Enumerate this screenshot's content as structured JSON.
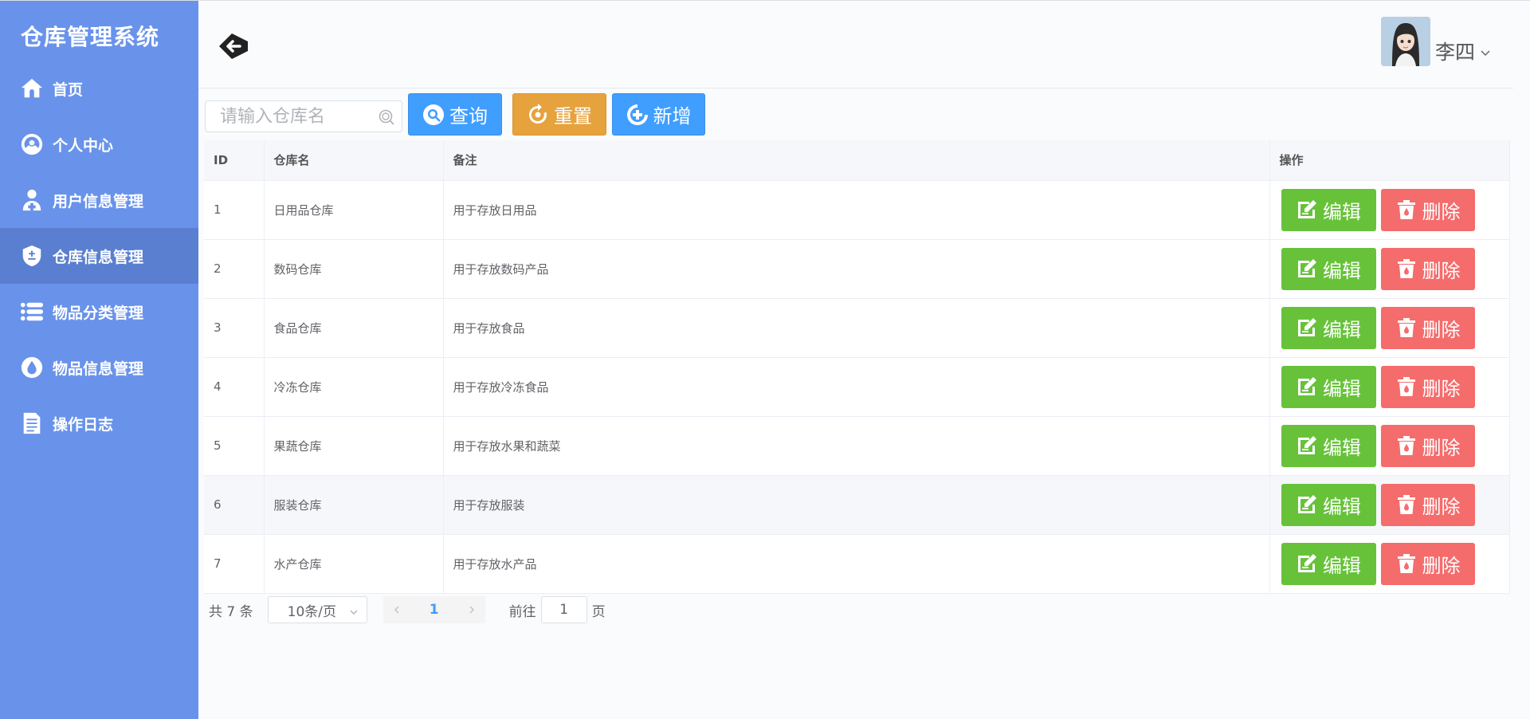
{
  "sidebar": {
    "title": "仓库管理系统",
    "items": [
      {
        "label": "首页",
        "icon": "home-icon"
      },
      {
        "label": "个人中心",
        "icon": "user-center-icon"
      },
      {
        "label": "用户信息管理",
        "icon": "user-add-icon"
      },
      {
        "label": "仓库信息管理",
        "icon": "shield-icon",
        "active": true
      },
      {
        "label": "物品分类管理",
        "icon": "list-icon"
      },
      {
        "label": "物品信息管理",
        "icon": "drop-icon"
      },
      {
        "label": "操作日志",
        "icon": "document-icon"
      }
    ]
  },
  "header": {
    "username": "李四"
  },
  "toolbar": {
    "search_placeholder": "请输入仓库名",
    "query_label": "查询",
    "reset_label": "重置",
    "add_label": "新增"
  },
  "table": {
    "columns": [
      "ID",
      "仓库名",
      "备注",
      "操作"
    ],
    "rows": [
      {
        "id": "1",
        "name": "日用品仓库",
        "remark": "用于存放日用品"
      },
      {
        "id": "2",
        "name": "数码仓库",
        "remark": "用于存放数码产品"
      },
      {
        "id": "3",
        "name": "食品仓库",
        "remark": "用于存放食品"
      },
      {
        "id": "4",
        "name": "冷冻仓库",
        "remark": "用于存放冷冻食品"
      },
      {
        "id": "5",
        "name": "果蔬仓库",
        "remark": "用于存放水果和蔬菜"
      },
      {
        "id": "6",
        "name": "服装仓库",
        "remark": "用于存放服装"
      },
      {
        "id": "7",
        "name": "水产仓库",
        "remark": "用于存放水产品"
      }
    ],
    "edit_label": "编辑",
    "delete_label": "删除"
  },
  "pagination": {
    "total_text": "共 7 条",
    "page_size": "10条/页",
    "current_page": "1",
    "goto_label": "前往",
    "goto_value": "1",
    "goto_suffix": "页"
  },
  "colors": {
    "sidebar_bg": "#6993ea",
    "sidebar_active": "#5a7fd0",
    "primary": "#409eff",
    "warning": "#e6a23c",
    "success": "#67c23a",
    "danger": "#f56c6c"
  }
}
